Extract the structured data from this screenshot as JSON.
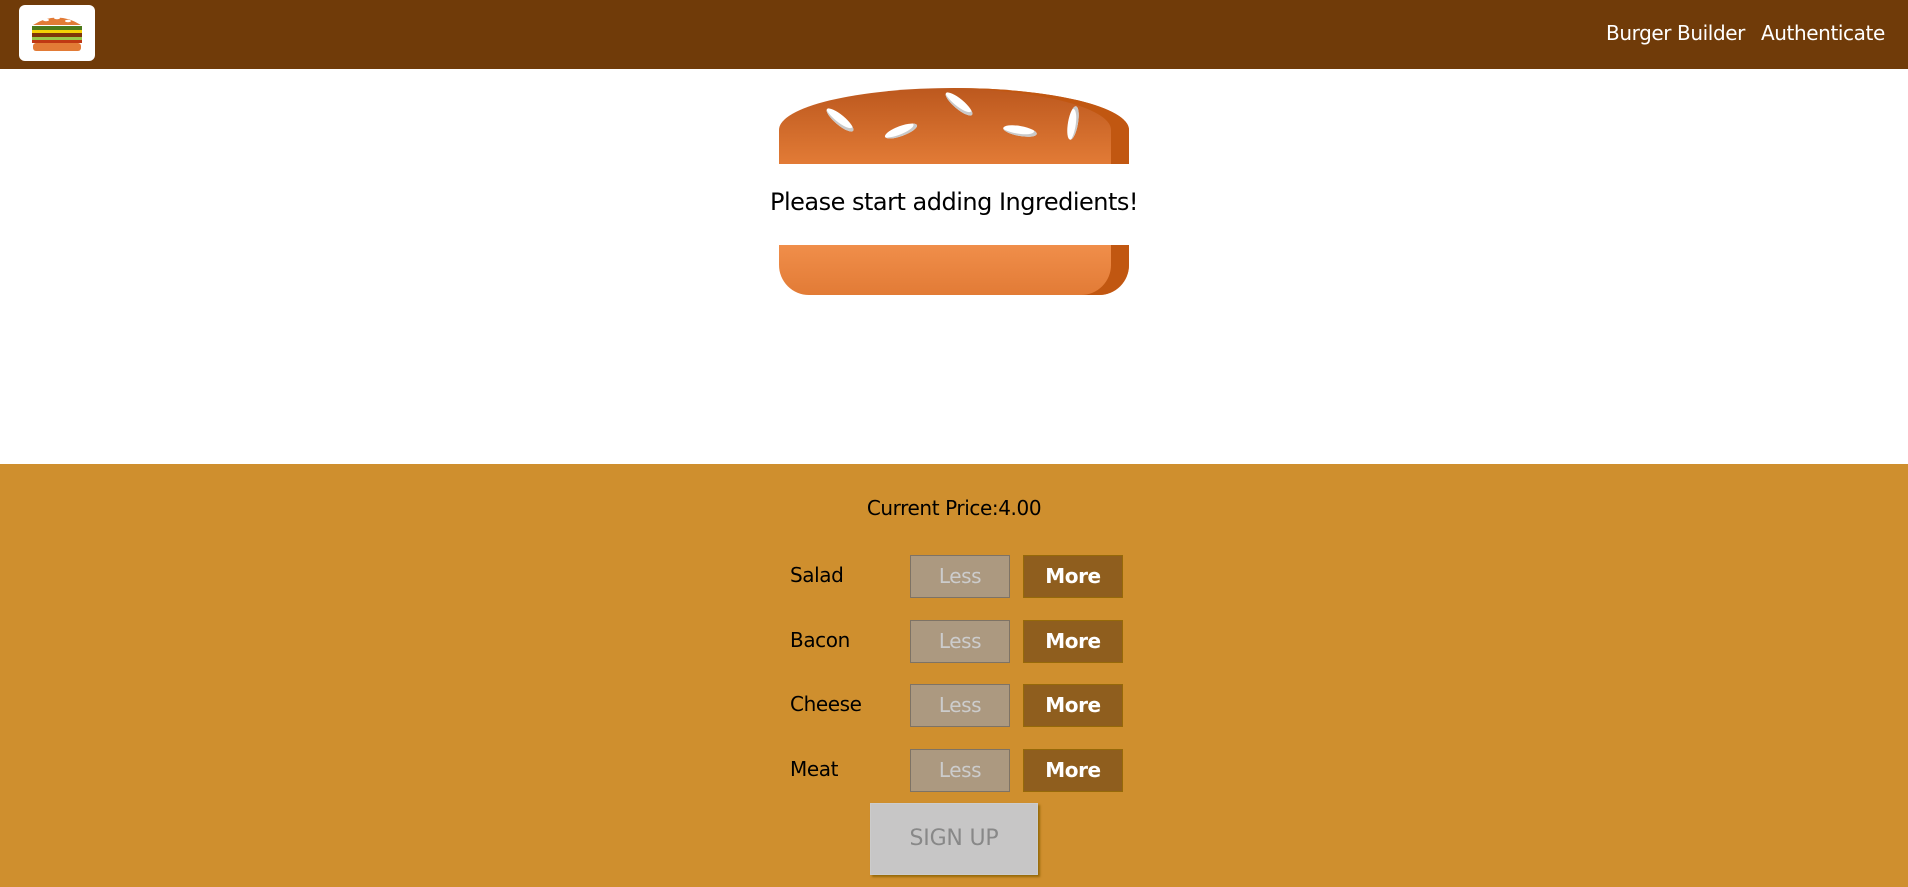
{
  "toolbar": {
    "nav": [
      {
        "label": "Burger Builder"
      },
      {
        "label": "Authenticate"
      }
    ]
  },
  "burger": {
    "message": "Please start adding Ingredients!"
  },
  "build_controls": {
    "price_label": "Current Price:",
    "price_value": "4.00",
    "controls": [
      {
        "label": "Salad",
        "less": "Less",
        "more": "More"
      },
      {
        "label": "Bacon",
        "less": "Less",
        "more": "More"
      },
      {
        "label": "Cheese",
        "less": "Less",
        "more": "More"
      },
      {
        "label": "Meat",
        "less": "Less",
        "more": "More"
      }
    ],
    "order_button": "SIGN UP"
  },
  "colors": {
    "toolbar": "#703b09",
    "controls_background": "#cf8f2e",
    "more_button": "#8f5e1e",
    "less_button_disabled": "#ac9980",
    "order_button_disabled": "#c7c6c6"
  }
}
